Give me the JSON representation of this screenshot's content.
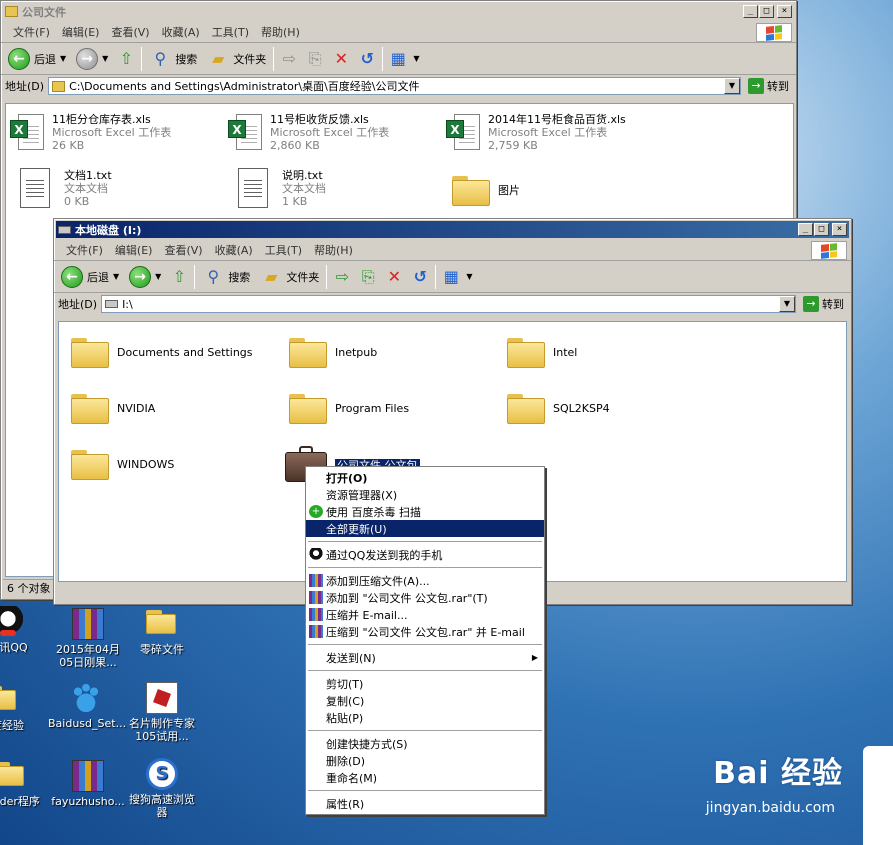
{
  "back_window": {
    "title": "公司文件",
    "menu": [
      "文件(F)",
      "编辑(E)",
      "查看(V)",
      "收藏(A)",
      "工具(T)",
      "帮助(H)"
    ],
    "toolbar": {
      "back": "后退",
      "search": "搜索",
      "folders": "文件夹"
    },
    "address_label": "地址(D)",
    "address_value": "C:\\Documents and Settings\\Administrator\\桌面\\百度经验\\公司文件",
    "goto": "转到",
    "files": [
      {
        "name": "11柜分仓库存表.xls",
        "type": "Microsoft Excel 工作表",
        "size": "26 KB",
        "icon": "excel-icon"
      },
      {
        "name": "11号柜收货反馈.xls",
        "type": "Microsoft Excel 工作表",
        "size": "2,860 KB",
        "icon": "excel-icon"
      },
      {
        "name": "2014年11号柜食品百货.xls",
        "type": "Microsoft Excel 工作表",
        "size": "2,759 KB",
        "icon": "excel-icon"
      },
      {
        "name": "文档1.txt",
        "type": "文本文档",
        "size": "0 KB",
        "icon": "text-file-icon"
      },
      {
        "name": "说明.txt",
        "type": "文本文档",
        "size": "1 KB",
        "icon": "text-file-icon"
      },
      {
        "name": "图片",
        "type": "",
        "size": "",
        "icon": "folder-icon"
      }
    ],
    "status": "6 个对象"
  },
  "front_window": {
    "title": "本地磁盘 (I:)",
    "menu": [
      "文件(F)",
      "编辑(E)",
      "查看(V)",
      "收藏(A)",
      "工具(T)",
      "帮助(H)"
    ],
    "toolbar": {
      "back": "后退",
      "search": "搜索",
      "folders": "文件夹"
    },
    "address_label": "地址(D)",
    "address_value": "I:\\",
    "goto": "转到",
    "folders": [
      "Documents and Settings",
      "Inetpub",
      "Intel",
      "NVIDIA",
      "Program Files",
      "SQL2KSP4",
      "WINDOWS"
    ],
    "selected_item": "公司文件 公文包"
  },
  "context_menu": [
    {
      "label": "打开(O)",
      "bold": true
    },
    {
      "label": "资源管理器(X)"
    },
    {
      "label": "使用 百度杀毒 扫描",
      "icon": "shield-icon"
    },
    {
      "label": "全部更新(U)",
      "highlighted": true
    },
    {
      "sep": true
    },
    {
      "label": "通过QQ发送到我的手机",
      "icon": "qq-icon"
    },
    {
      "sep": true
    },
    {
      "label": "添加到压缩文件(A)...",
      "icon": "archive-icon"
    },
    {
      "label": "添加到 \"公司文件 公文包.rar\"(T)",
      "icon": "archive-icon"
    },
    {
      "label": "压缩并 E-mail...",
      "icon": "archive-icon"
    },
    {
      "label": "压缩到 \"公司文件 公文包.rar\" 并 E-mail",
      "icon": "archive-icon"
    },
    {
      "sep": true
    },
    {
      "label": "发送到(N)",
      "submenu": true
    },
    {
      "sep": true
    },
    {
      "label": "剪切(T)"
    },
    {
      "label": "复制(C)"
    },
    {
      "label": "粘贴(P)"
    },
    {
      "sep": true
    },
    {
      "label": "创建快捷方式(S)"
    },
    {
      "label": "删除(D)"
    },
    {
      "label": "重命名(M)"
    },
    {
      "sep": true
    },
    {
      "label": "属性(R)"
    }
  ],
  "desktop_icons": [
    {
      "label": "腾讯QQ",
      "icon": "qq-icon"
    },
    {
      "label": "2015年04月05日刚果...",
      "icon": "archive-icon"
    },
    {
      "label": "零碎文件",
      "icon": "folder-shortcut-icon"
    },
    {
      "label": "百度经验",
      "icon": "folder-icon"
    },
    {
      "label": "Baidusd_Set...",
      "icon": "baidu-paw-icon"
    },
    {
      "label": "名片制作专家105试用...",
      "icon": "card-app-icon"
    },
    {
      "label": "Leader程序",
      "icon": "folder-icon"
    },
    {
      "label": "fayuzhusho...",
      "icon": "archive-icon"
    },
    {
      "label": "搜狗高速浏览器",
      "icon": "sogou-browser-icon"
    }
  ],
  "watermark": {
    "brand": "Bai 经验",
    "url": "jingyan.baidu.com"
  }
}
